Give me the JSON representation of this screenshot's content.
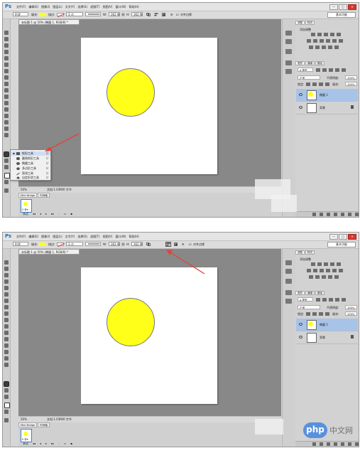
{
  "app": {
    "logo": "Ps",
    "menus": [
      "文件(F)",
      "编辑(E)",
      "图像(I)",
      "图层(L)",
      "文字(Y)",
      "选择(S)",
      "滤镜(T)",
      "视图(V)",
      "窗口(W)",
      "帮助(H)"
    ],
    "window_buttons": [
      "—",
      "□",
      "×"
    ],
    "workspace": "基本功能"
  },
  "colors": {
    "app_bg": "#d6d6d6",
    "doc_bg": "#888888",
    "fill_color": "#ffff1a",
    "stroke_swatch": "#d83a3a",
    "selection": "#a8c3e8",
    "arrow": "#e0443a"
  },
  "options_bar": {
    "mode": "形状",
    "fill_label": "填充:",
    "stroke_label": "描边:",
    "stroke_width": "3 点",
    "w_label": "W:",
    "w_value": "362 像",
    "link_icon": "link-icon",
    "h_label": "H:",
    "h_value": "362 像",
    "align_edges_label": "对齐边缘"
  },
  "document": {
    "tab": "未标题-1 @ 50% (椭圆 1, RGB/8) *",
    "zoom": "50%",
    "doc_info": "文档:1.03M/0 字节"
  },
  "timeline": {
    "tabs": [
      "Mini Bridge",
      "时间轴"
    ],
    "frame_time": "0 秒▾",
    "loop": "永远"
  },
  "panels": {
    "top_tabs": [
      "调整",
      "样式"
    ],
    "adjust_title": "添加调整",
    "layer_tabs": [
      "图层",
      "通道",
      "路径"
    ],
    "kind_filter": "ρ 类型",
    "blend_mode": "正常",
    "opacity_label": "不透明度:",
    "opacity": "100%",
    "lock_label": "锁定:",
    "fill_label": "填充:",
    "fill": "100%",
    "layers": [
      {
        "name": "椭圆 1"
      },
      {
        "name": "背景"
      }
    ]
  },
  "flyout": {
    "items": [
      {
        "label": "矩形工具",
        "key": "U"
      },
      {
        "label": "圆角矩形工具",
        "key": "U"
      },
      {
        "label": "椭圆工具",
        "key": "U"
      },
      {
        "label": "多边形工具",
        "key": "U"
      },
      {
        "label": "直线工具",
        "key": "U"
      },
      {
        "label": "自定形状工具",
        "key": "U"
      }
    ]
  },
  "watermark": {
    "logo": "php",
    "text": "中文网"
  }
}
